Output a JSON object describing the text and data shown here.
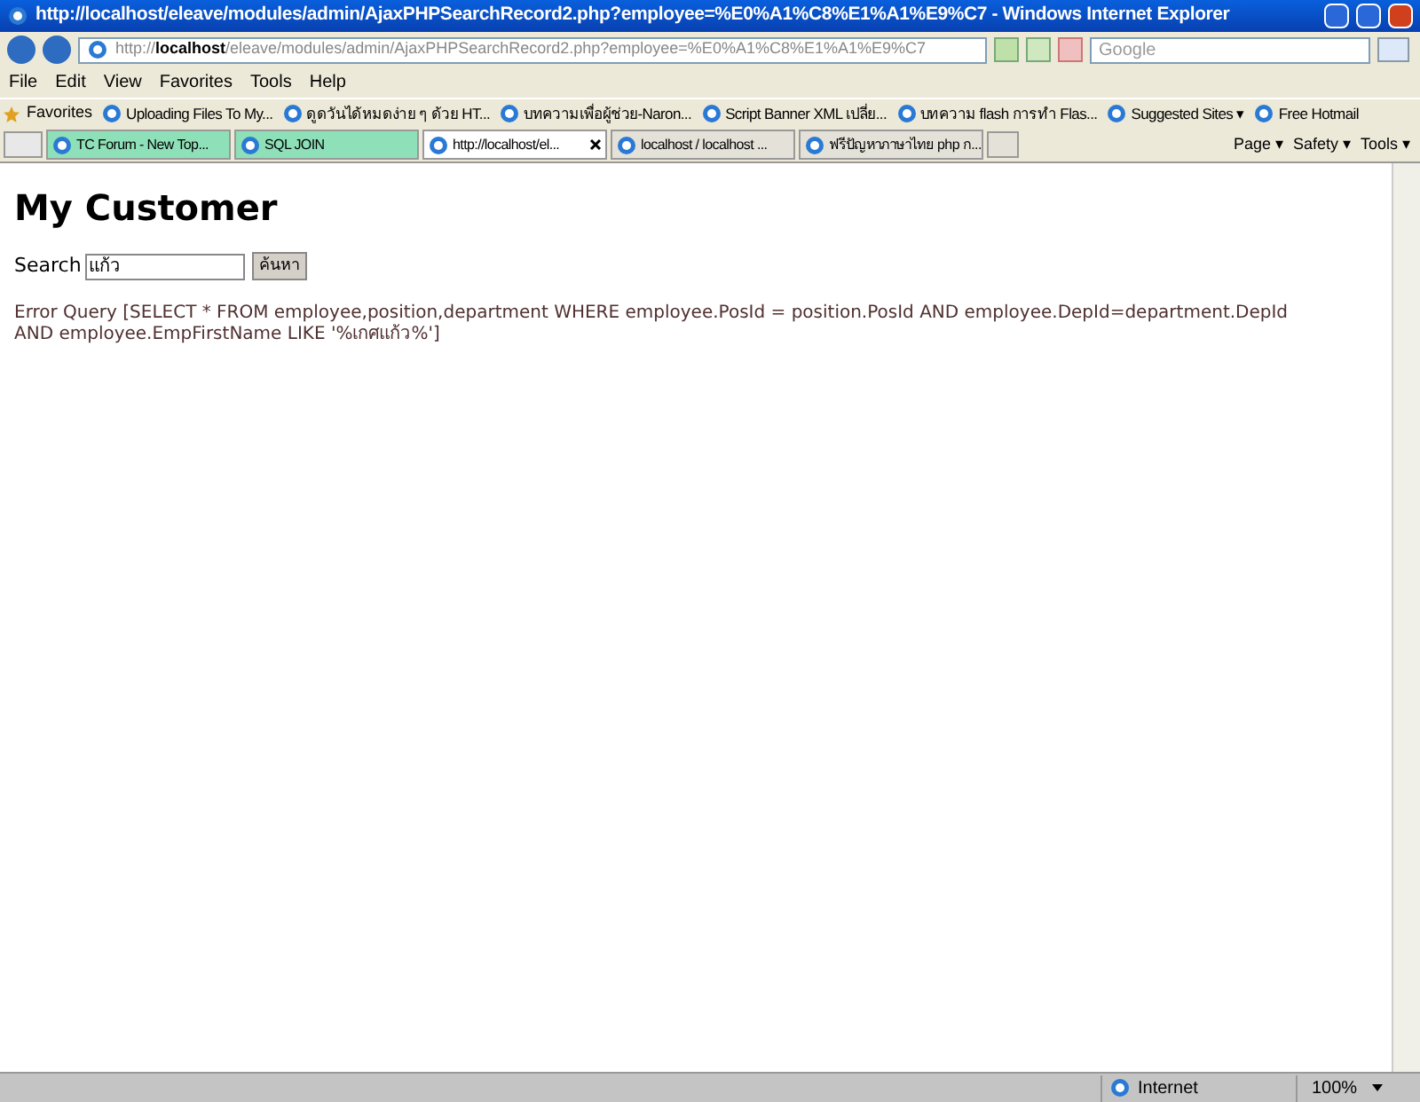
{
  "window": {
    "title": "http://localhost/eleave/modules/admin/AjaxPHPSearchRecord2.php?employee=%E0%A1%C8%E1%A1%E9%C7 - Windows Internet Explorer"
  },
  "address_bar": {
    "url_prefix": "http://",
    "url_host": "localhost",
    "url_rest": "/eleave/modules/admin/AjaxPHPSearchRecord2.php?employee=%E0%A1%C8%E1%A1%E9%C7"
  },
  "search_box": {
    "placeholder": "Google"
  },
  "menu": [
    "File",
    "Edit",
    "View",
    "Favorites",
    "Tools",
    "Help"
  ],
  "favorites_bar": {
    "label": "Favorites",
    "items": [
      {
        "label": "Uploading Files To My..."
      },
      {
        "label": "ดูดวันได้หมดง่าย ๆ ด้วย HT..."
      },
      {
        "label": "บทความเพื่อผู้ช่วย-Naron..."
      },
      {
        "label": "Script Banner XML เปลี่ย..."
      },
      {
        "label": "บทความ flash การทำ Flas..."
      },
      {
        "label": "Suggested Sites ▾"
      },
      {
        "label": "Free Hotmail"
      }
    ]
  },
  "tabs": [
    {
      "label": "TC Forum - New Top...",
      "selected": false,
      "color": "#8ee0b8"
    },
    {
      "label": "SQL JOIN",
      "selected": false,
      "color": "#8ee0b8"
    },
    {
      "label": "http://localhost/el...",
      "selected": true
    },
    {
      "label": "localhost / localhost ...",
      "selected": false
    },
    {
      "label": "ฟรีปัญหาภาษาไทย php ก...",
      "selected": false
    }
  ],
  "command_bar": [
    "Page ▾",
    "Safety ▾",
    "Tools ▾"
  ],
  "page": {
    "heading": "My Customer",
    "search_label": "Search",
    "search_value": "แก้ว",
    "search_button": "ค้นหา",
    "error": "Error Query [SELECT * FROM employee,position,department WHERE employee.PosId = position.PosId AND employee.DepId=department.DepId AND employee.EmpFirstName LIKE '%เกศแก้ว%']"
  },
  "status_bar": {
    "zone": "Internet",
    "zoom": "100%"
  }
}
